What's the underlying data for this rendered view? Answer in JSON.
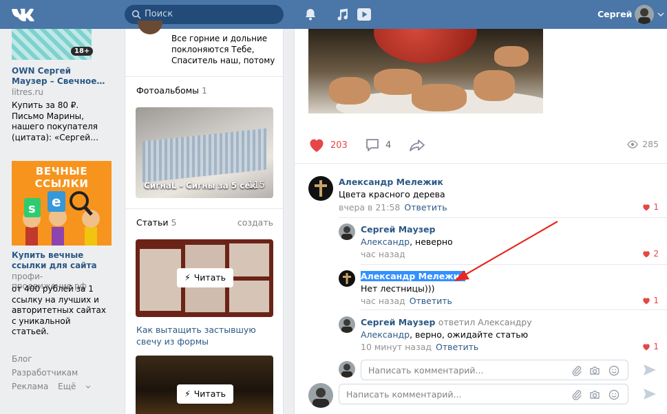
{
  "header": {
    "logo_text": "VK",
    "search_placeholder": "Поиск",
    "user_name": "Сергей"
  },
  "left_ads": {
    "ad1": {
      "age_badge": "18+",
      "title": "OWN Сергей Маузер – Свечное…",
      "domain": "litres.ru",
      "description": "Купить за 80 ₽. Письмо Марины, нашего покупателя (цитата): «Сергей…"
    },
    "ad2": {
      "banner": "ВЕЧНЫЕ ССЫЛКИ",
      "title": "Купить вечные ссылки для сайта",
      "domain": "профи-продвижение.рф",
      "description": "от 400 рублей за 1 ссылку на лучших и авторитетных сайтах с уникальной статьей."
    },
    "footer": {
      "blog": "Блог",
      "developers": "Разработчикам",
      "ads": "Реклама",
      "more": "Ещё"
    }
  },
  "middle": {
    "quote": "Все горние и дольние поклоняются Тебе, Спаситель наш, потому",
    "albums": {
      "label": "Фотоальбомы",
      "count": "1",
      "caption": "СигнаL - Сигны за 5 сек",
      "photo_count": "115"
    },
    "articles": {
      "label": "Статьи",
      "count": "5",
      "create": "создать",
      "read_label": "Читать",
      "article1_title": "Как вытащить застывшую свечу из формы"
    }
  },
  "post": {
    "likes": "203",
    "comments": "4",
    "views": "285"
  },
  "comments": [
    {
      "author": "Александр Мележик",
      "text": "Цвета красного дерева",
      "time": "вчера в 21:58",
      "reply": "Ответить",
      "likes": "1"
    },
    {
      "author": "Сергей Маузер",
      "mention": "Александр",
      "text": ", неверно",
      "time": "час назад",
      "likes": "2"
    },
    {
      "author": "Александр Мележик",
      "text": "Нет лестницы)))",
      "time": "час назад",
      "reply": "Ответить",
      "likes": "1"
    },
    {
      "author": "Сергей Маузер",
      "replied_to": "ответил Александру",
      "mention": "Александр",
      "text": ", верно, ожидайте статью",
      "time": "10 минут назад",
      "reply": "Ответить",
      "likes": "1"
    }
  ],
  "comment_input": {
    "placeholder": "Написать комментарий..."
  },
  "colors": {
    "header_bg": "#4a76a8",
    "link": "#2a5885",
    "like_red": "#e64646",
    "selection": "#3390ff",
    "annotation_arrow": "#e8271f"
  }
}
